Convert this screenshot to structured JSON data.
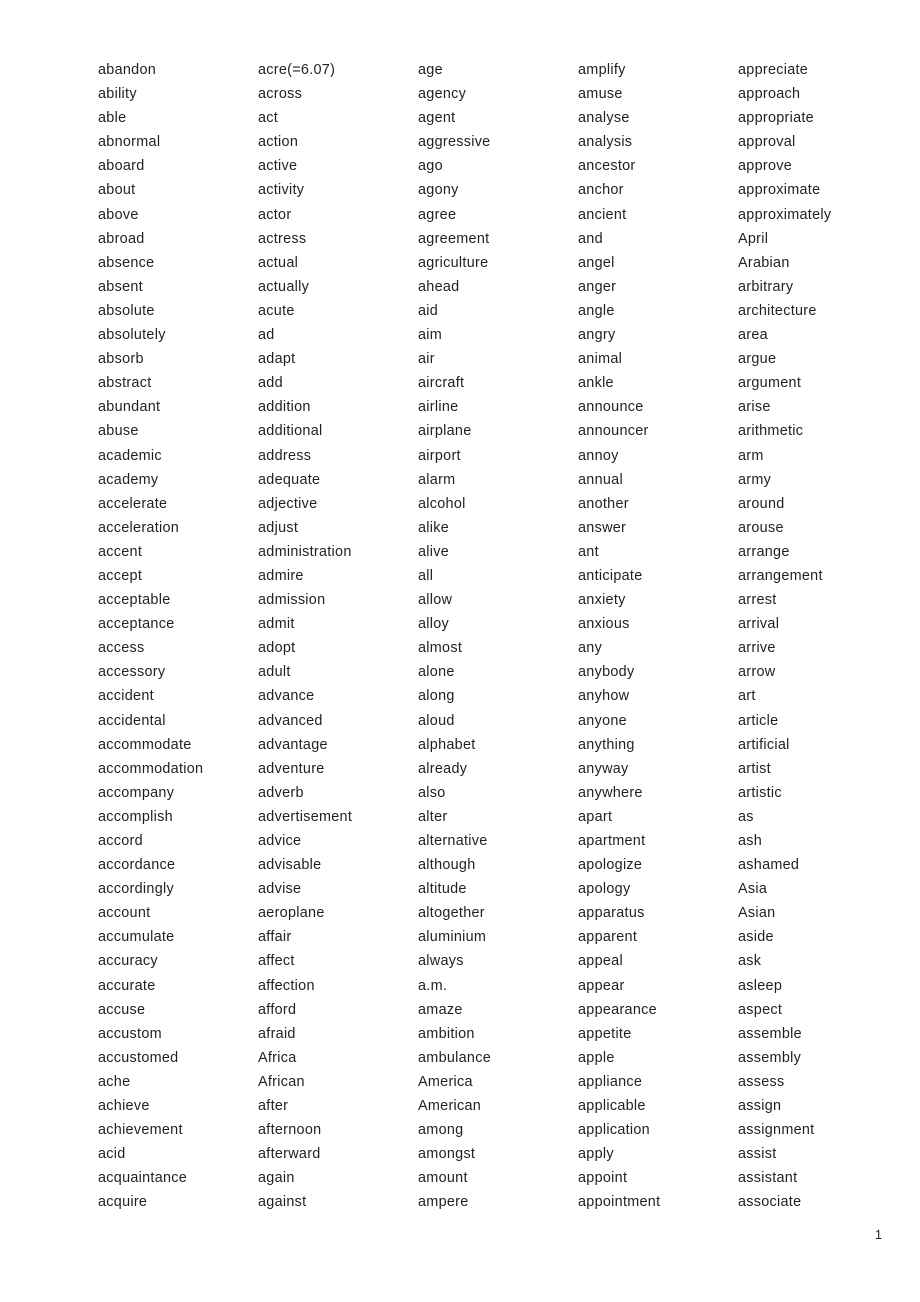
{
  "document": {
    "page_number": "1",
    "columns": [
      {
        "index": 1,
        "words": [
          "abandon",
          "ability",
          "able",
          "abnormal",
          "aboard",
          "about",
          "above",
          "abroad",
          "absence",
          "absent",
          "absolute",
          "absolutely",
          "absorb",
          "abstract",
          "abundant",
          "abuse",
          "academic",
          "academy",
          "accelerate",
          "acceleration",
          "accent",
          "accept",
          "acceptable",
          "acceptance",
          "access",
          "accessory",
          "accident",
          "accidental",
          "accommodate",
          "accommodation",
          "accompany",
          "accomplish",
          "accord",
          "accordance",
          "accordingly",
          "account",
          "accumulate",
          "accuracy",
          "accurate",
          "accuse",
          "accustom",
          "accustomed",
          "ache",
          "achieve",
          "achievement",
          "acid",
          "acquaintance",
          "acquire"
        ]
      },
      {
        "index": 2,
        "words": [
          "acre(=6.07)",
          "across",
          "act",
          "action",
          "active",
          "activity",
          "actor",
          "actress",
          "actual",
          "actually",
          "acute",
          "ad",
          "adapt",
          "add",
          "addition",
          "additional",
          "address",
          "adequate",
          "adjective",
          "adjust",
          "administration",
          "admire",
          "admission",
          "admit",
          "adopt",
          "adult",
          "advance",
          "advanced",
          "advantage",
          "adventure",
          "adverb",
          "advertisement",
          "advice",
          "advisable",
          "advise",
          "aeroplane",
          "affair",
          "affect",
          "affection",
          "afford",
          "afraid",
          "Africa",
          "African",
          "after",
          "afternoon",
          "afterward",
          "again",
          "against"
        ]
      },
      {
        "index": 3,
        "words": [
          "age",
          "agency",
          "agent",
          "aggressive",
          "ago",
          "agony",
          "agree",
          "agreement",
          "agriculture",
          "ahead",
          "aid",
          "aim",
          "air",
          "aircraft",
          "airline",
          "airplane",
          "airport",
          "alarm",
          "alcohol",
          "alike",
          "alive",
          "all",
          "allow",
          "alloy",
          "almost",
          "alone",
          "along",
          "aloud",
          "alphabet",
          "already",
          "also",
          "alter",
          "alternative",
          "although",
          "altitude",
          "altogether",
          "aluminium",
          "always",
          "a.m.",
          "amaze",
          "ambition",
          "ambulance",
          "America",
          "American",
          "among",
          "amongst",
          "amount",
          "ampere"
        ]
      },
      {
        "index": 4,
        "words": [
          "amplify",
          "amuse",
          "analyse",
          "analysis",
          "ancestor",
          "anchor",
          "ancient",
          "and",
          "angel",
          "anger",
          "angle",
          "angry",
          "animal",
          "ankle",
          "announce",
          "announcer",
          "annoy",
          "annual",
          "another",
          "answer",
          "ant",
          "anticipate",
          "anxiety",
          "anxious",
          "any",
          "anybody",
          "anyhow",
          "anyone",
          "anything",
          "anyway",
          "anywhere",
          "apart",
          "apartment",
          "apologize",
          "apology",
          "apparatus",
          "apparent",
          "appeal",
          "appear",
          "appearance",
          "appetite",
          "apple",
          "appliance",
          "applicable",
          "application",
          "apply",
          "appoint",
          "appointment"
        ]
      },
      {
        "index": 5,
        "words": [
          "appreciate",
          "approach",
          "appropriate",
          "approval",
          "approve",
          "approximate",
          "approximately",
          "April",
          "Arabian",
          "arbitrary",
          "architecture",
          "area",
          "argue",
          "argument",
          "arise",
          "arithmetic",
          "arm",
          "army",
          "around",
          "arouse",
          "arrange",
          "arrangement",
          "arrest",
          "arrival",
          "arrive",
          "arrow",
          "art",
          "article",
          "artificial",
          "artist",
          "artistic",
          "as",
          "ash",
          "ashamed",
          "Asia",
          "Asian",
          "aside",
          "ask",
          "asleep",
          "aspect",
          "assemble",
          "assembly",
          "assess",
          "assign",
          "assignment",
          "assist",
          "assistant",
          "associate"
        ]
      }
    ]
  }
}
